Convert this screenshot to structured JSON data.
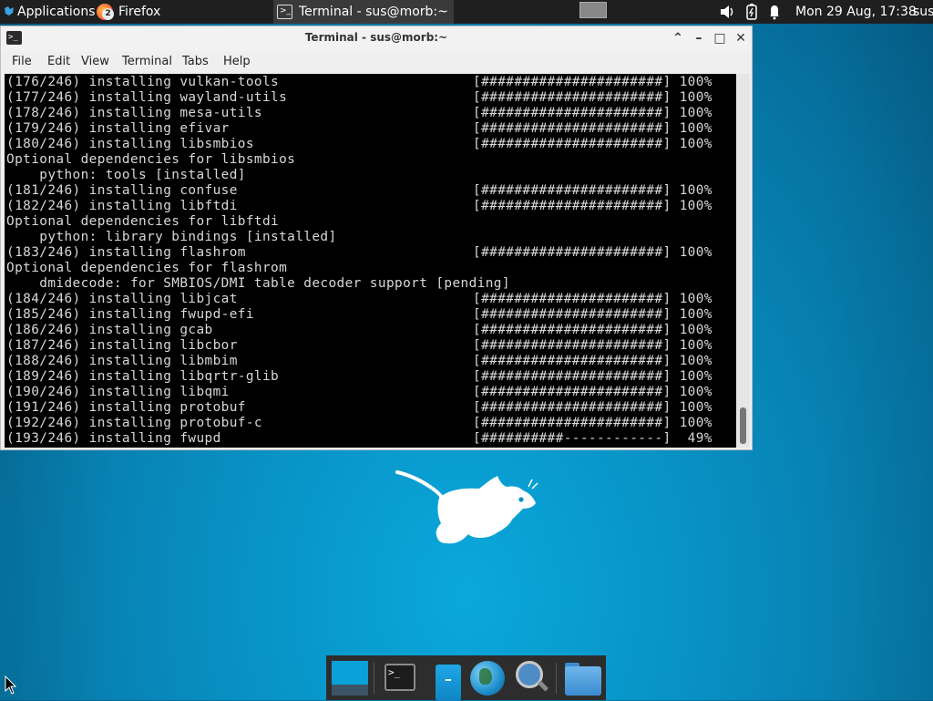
{
  "panel": {
    "applications_label": "Applications",
    "firefox_label": "Firefox",
    "firefox_badge": "2",
    "terminal_task_label": "Terminal - sus@morb:~",
    "clock": "Mon 29 Aug, 17:38",
    "user": "sus"
  },
  "terminal": {
    "title": "Terminal - sus@morb:~",
    "menu": [
      "File",
      "Edit",
      "View",
      "Terminal",
      "Tabs",
      "Help"
    ],
    "lines": [
      {
        "text": "(176/246) installing vulkan-tools",
        "bar": "[######################] 100%"
      },
      {
        "text": "(177/246) installing wayland-utils",
        "bar": "[######################] 100%"
      },
      {
        "text": "(178/246) installing mesa-utils",
        "bar": "[######################] 100%"
      },
      {
        "text": "(179/246) installing efivar",
        "bar": "[######################] 100%"
      },
      {
        "text": "(180/246) installing libsmbios",
        "bar": "[######################] 100%"
      },
      {
        "text": "Optional dependencies for libsmbios",
        "bar": ""
      },
      {
        "text": "    python: tools [installed]",
        "bar": ""
      },
      {
        "text": "(181/246) installing confuse",
        "bar": "[######################] 100%"
      },
      {
        "text": "(182/246) installing libftdi",
        "bar": "[######################] 100%"
      },
      {
        "text": "Optional dependencies for libftdi",
        "bar": ""
      },
      {
        "text": "    python: library bindings [installed]",
        "bar": ""
      },
      {
        "text": "(183/246) installing flashrom",
        "bar": "[######################] 100%"
      },
      {
        "text": "Optional dependencies for flashrom",
        "bar": ""
      },
      {
        "text": "    dmidecode: for SMBIOS/DMI table decoder support [pending]",
        "bar": ""
      },
      {
        "text": "(184/246) installing libjcat",
        "bar": "[######################] 100%"
      },
      {
        "text": "(185/246) installing fwupd-efi",
        "bar": "[######################] 100%"
      },
      {
        "text": "(186/246) installing gcab",
        "bar": "[######################] 100%"
      },
      {
        "text": "(187/246) installing libcbor",
        "bar": "[######################] 100%"
      },
      {
        "text": "(188/246) installing libmbim",
        "bar": "[######################] 100%"
      },
      {
        "text": "(189/246) installing libqrtr-glib",
        "bar": "[######################] 100%"
      },
      {
        "text": "(190/246) installing libqmi",
        "bar": "[######################] 100%"
      },
      {
        "text": "(191/246) installing protobuf",
        "bar": "[######################] 100%"
      },
      {
        "text": "(192/246) installing protobuf-c",
        "bar": "[######################] 100%"
      },
      {
        "text": "(193/246) installing fwupd",
        "bar": "[##########------------]  49%"
      }
    ]
  },
  "icons": {
    "apps": "xfce-mouse-icon",
    "volume": "volume-icon",
    "battery": "battery-icon",
    "notifications": "bell-icon"
  },
  "colors": {
    "desktop": "#0891c4",
    "panel": "#1f1f1f",
    "terminal_bg": "#000000",
    "terminal_fg": "#d8d8d8"
  }
}
